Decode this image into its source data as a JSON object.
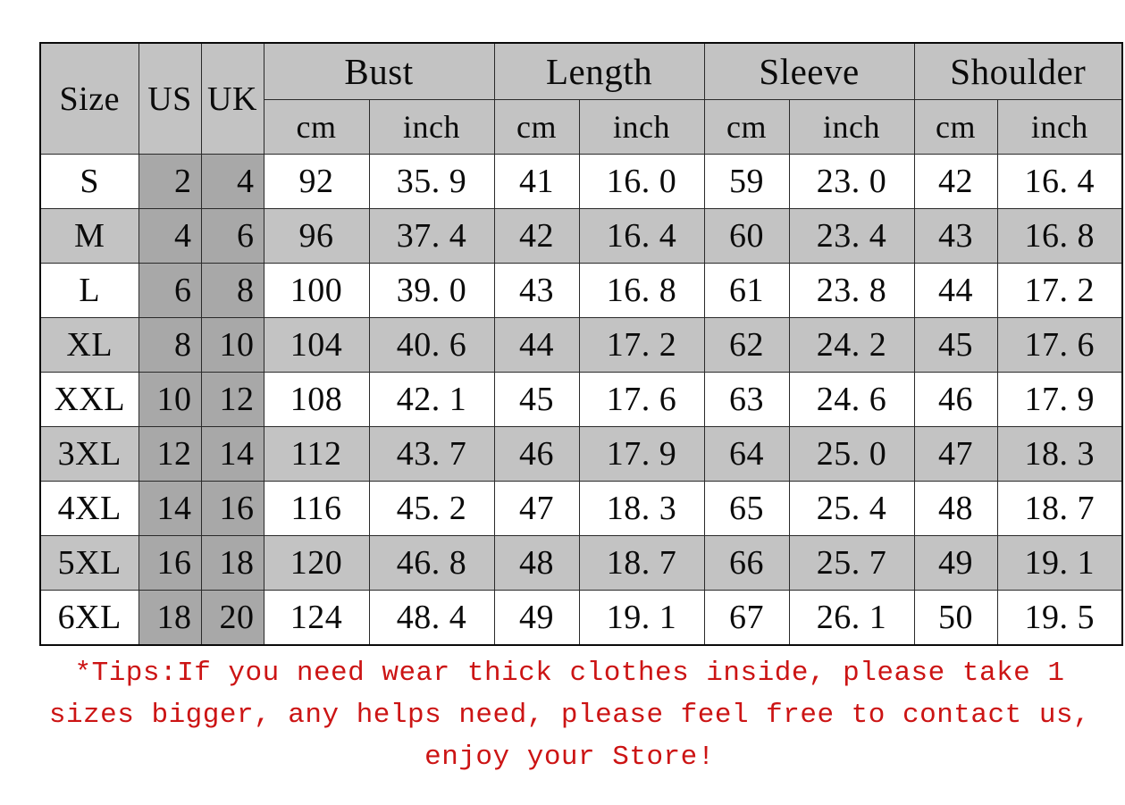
{
  "table": {
    "headers": {
      "size": "Size",
      "us": "US",
      "uk": "UK",
      "groups": [
        "Bust",
        "Length",
        "Sleeve",
        "Shoulder"
      ],
      "unit_cm": "cm",
      "unit_inch": "inch"
    },
    "rows": [
      {
        "size": "S",
        "us": "2",
        "uk": "4",
        "bust_cm": "92",
        "bust_inch": "35. 9",
        "length_cm": "41",
        "length_inch": "16. 0",
        "sleeve_cm": "59",
        "sleeve_inch": "23. 0",
        "shoulder_cm": "42",
        "shoulder_inch": "16. 4"
      },
      {
        "size": "M",
        "us": "4",
        "uk": "6",
        "bust_cm": "96",
        "bust_inch": "37. 4",
        "length_cm": "42",
        "length_inch": "16. 4",
        "sleeve_cm": "60",
        "sleeve_inch": "23. 4",
        "shoulder_cm": "43",
        "shoulder_inch": "16. 8"
      },
      {
        "size": "L",
        "us": "6",
        "uk": "8",
        "bust_cm": "100",
        "bust_inch": "39. 0",
        "length_cm": "43",
        "length_inch": "16. 8",
        "sleeve_cm": "61",
        "sleeve_inch": "23. 8",
        "shoulder_cm": "44",
        "shoulder_inch": "17. 2"
      },
      {
        "size": "XL",
        "us": "8",
        "uk": "10",
        "bust_cm": "104",
        "bust_inch": "40. 6",
        "length_cm": "44",
        "length_inch": "17. 2",
        "sleeve_cm": "62",
        "sleeve_inch": "24. 2",
        "shoulder_cm": "45",
        "shoulder_inch": "17. 6"
      },
      {
        "size": "XXL",
        "us": "10",
        "uk": "12",
        "bust_cm": "108",
        "bust_inch": "42. 1",
        "length_cm": "45",
        "length_inch": "17. 6",
        "sleeve_cm": "63",
        "sleeve_inch": "24. 6",
        "shoulder_cm": "46",
        "shoulder_inch": "17. 9"
      },
      {
        "size": "3XL",
        "us": "12",
        "uk": "14",
        "bust_cm": "112",
        "bust_inch": "43. 7",
        "length_cm": "46",
        "length_inch": "17. 9",
        "sleeve_cm": "64",
        "sleeve_inch": "25. 0",
        "shoulder_cm": "47",
        "shoulder_inch": "18. 3"
      },
      {
        "size": "4XL",
        "us": "14",
        "uk": "16",
        "bust_cm": "116",
        "bust_inch": "45. 2",
        "length_cm": "47",
        "length_inch": "18. 3",
        "sleeve_cm": "65",
        "sleeve_inch": "25. 4",
        "shoulder_cm": "48",
        "shoulder_inch": "18. 7"
      },
      {
        "size": "5XL",
        "us": "16",
        "uk": "18",
        "bust_cm": "120",
        "bust_inch": "46. 8",
        "length_cm": "48",
        "length_inch": "18. 7",
        "sleeve_cm": "66",
        "sleeve_inch": "25. 7",
        "shoulder_cm": "49",
        "shoulder_inch": "19. 1"
      },
      {
        "size": "6XL",
        "us": "18",
        "uk": "20",
        "bust_cm": "124",
        "bust_inch": "48. 4",
        "length_cm": "49",
        "length_inch": "19. 1",
        "sleeve_cm": "67",
        "sleeve_inch": "26. 1",
        "shoulder_cm": "50",
        "shoulder_inch": "19. 5"
      }
    ]
  },
  "tips": {
    "text": "*Tips:If you need wear thick clothes inside, please take 1 sizes bigger, any helps need, please feel free to contact us, enjoy your Store!"
  },
  "colors": {
    "header_gray": "#c3c3c3",
    "stripe_gray": "#c3c3c3",
    "usuk_gray": "#a8a8a8",
    "tips_red": "#cc1414",
    "grid_line": "#2a2a2a",
    "page_background": "#ffffff"
  }
}
